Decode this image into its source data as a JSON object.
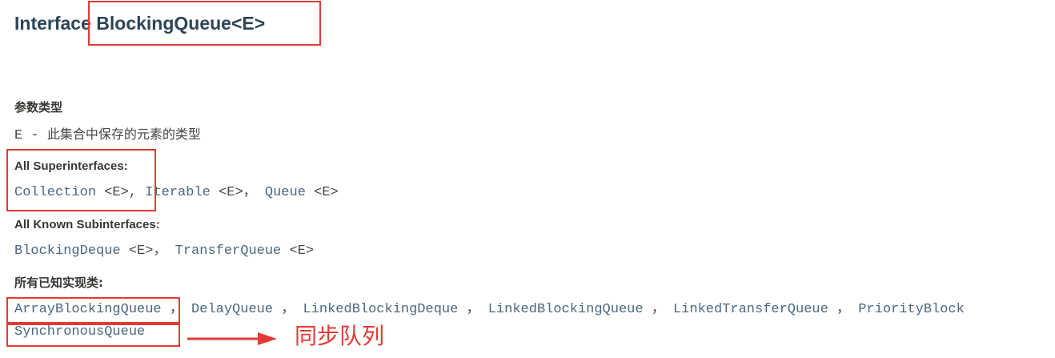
{
  "title": "Interface BlockingQueue<E>",
  "param_types": {
    "label": "参数类型",
    "param_name": "E",
    "separator": " - ",
    "desc": "此集合中保存的元素的类型"
  },
  "superinterfaces": {
    "label": "All Superinterfaces:",
    "items": [
      {
        "name": "Collection",
        "suffix": " <E>, "
      },
      {
        "name": "Iterable",
        "suffix": " <E>， "
      },
      {
        "name": "Queue",
        "suffix": " <E>"
      }
    ]
  },
  "subinterfaces": {
    "label": "All Known Subinterfaces:",
    "items": [
      {
        "name": "BlockingDeque",
        "suffix": " <E>， "
      },
      {
        "name": "TransferQueue",
        "suffix": " <E>"
      }
    ]
  },
  "implementing_classes": {
    "label": "所有已知实现类:",
    "items": [
      {
        "name": "ArrayBlockingQueue",
        "suffix": " ， "
      },
      {
        "name": "DelayQueue",
        "suffix": " ， "
      },
      {
        "name": "LinkedBlockingDeque",
        "suffix": " ， "
      },
      {
        "name": "LinkedBlockingQueue",
        "suffix": " ， "
      },
      {
        "name": "LinkedTransferQueue",
        "suffix": " ， "
      },
      {
        "name": "PriorityBlock",
        "suffix": ""
      }
    ],
    "second_line": "SynchronousQueue"
  },
  "annotation": {
    "note": "同步队列",
    "color": "#e53935"
  }
}
